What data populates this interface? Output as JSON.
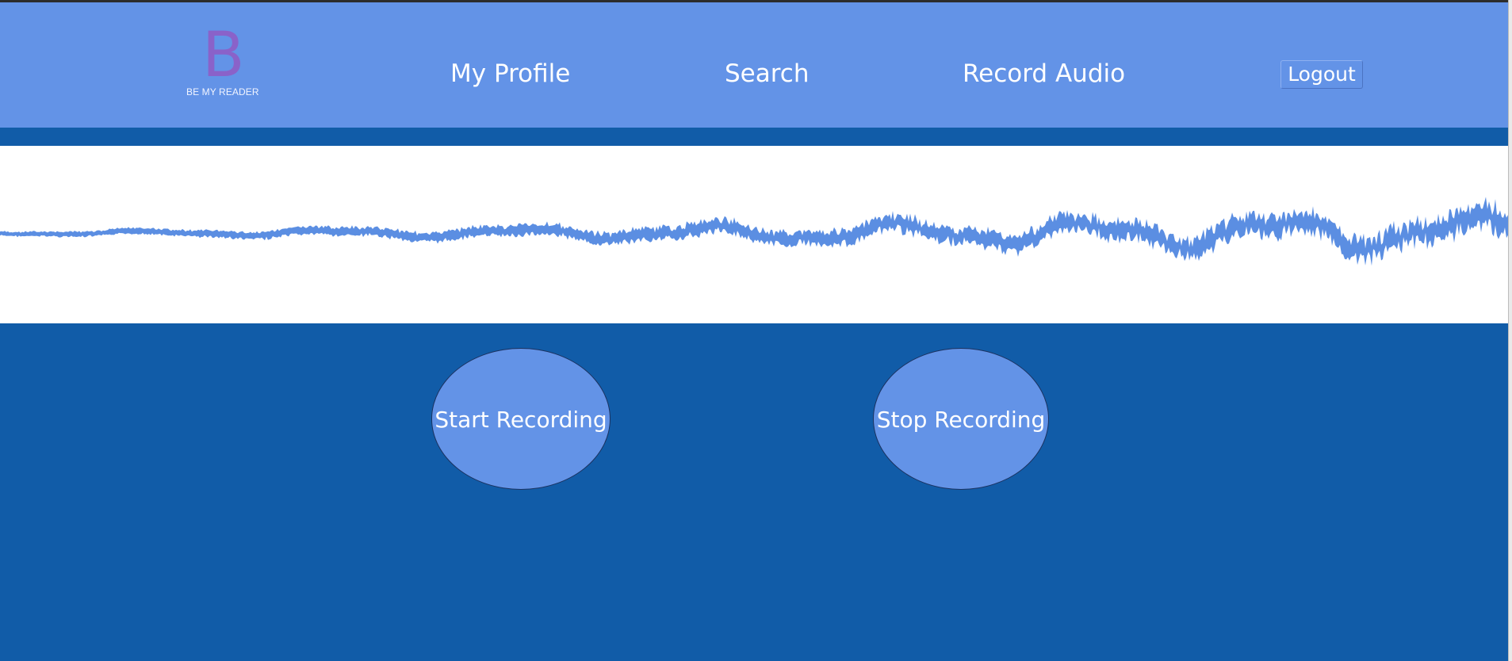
{
  "brand": {
    "logo_letter": "B",
    "logo_caption": "BE MY READER"
  },
  "nav": {
    "items": [
      {
        "label": "My Profile"
      },
      {
        "label": "Search"
      },
      {
        "label": "Record Audio"
      }
    ],
    "logout_label": "Logout"
  },
  "recorder": {
    "start_label": "Start Recording",
    "stop_label": "Stop Recording",
    "waveform_icon": "audio-waveform"
  },
  "colors": {
    "nav_background": "#6393e7",
    "page_background": "#115ca8",
    "logo_color": "#8a62c9",
    "waveform_color": "#5b8ee2",
    "button_fill": "#6393e7"
  }
}
